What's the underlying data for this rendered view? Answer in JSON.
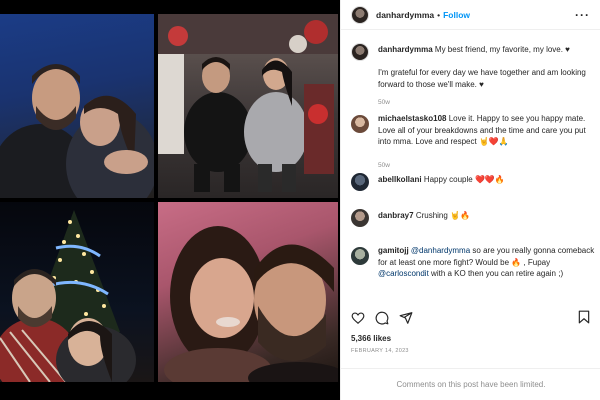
{
  "header": {
    "username": "danhardymma",
    "separator": "•",
    "follow_label": "Follow",
    "more_icon": "ellipsis-icon"
  },
  "caption": {
    "username": "danhardymma",
    "text_line1": "My best friend, my favorite, my love. ♥",
    "text_line2": "I'm grateful for every day we have together and am looking forward to those we'll make. ♥",
    "time": "50w"
  },
  "comments": [
    {
      "username": "michaelstasko108",
      "text": "Love it. Happy to see you happy mate. Love all of your breakdowns and the time and care you put into mma. Love and respect 🤘❤️🙏",
      "time": "50w"
    },
    {
      "username": "abellkollani",
      "text": "Happy couple ❤️❤️🔥",
      "time": ""
    },
    {
      "username": "danbray7",
      "text": "Crushing 🤘🔥",
      "time": ""
    },
    {
      "username": "gamitojj",
      "mention": "@danhardymma",
      "text_pre": "so are you really gonna comeback for at least one more fight? Would be 🔥 , Fupay",
      "mention2": "@carloscondit",
      "text_post": "with a KO then you can retire again ;)",
      "time": ""
    }
  ],
  "actions": {
    "like_icon": "heart-icon",
    "comment_icon": "comment-icon",
    "share_icon": "share-icon",
    "save_icon": "bookmark-icon"
  },
  "likes": "5,366 likes",
  "date": "FEBRUARY 14, 2023",
  "footer_note": "Comments on this post have been limited."
}
